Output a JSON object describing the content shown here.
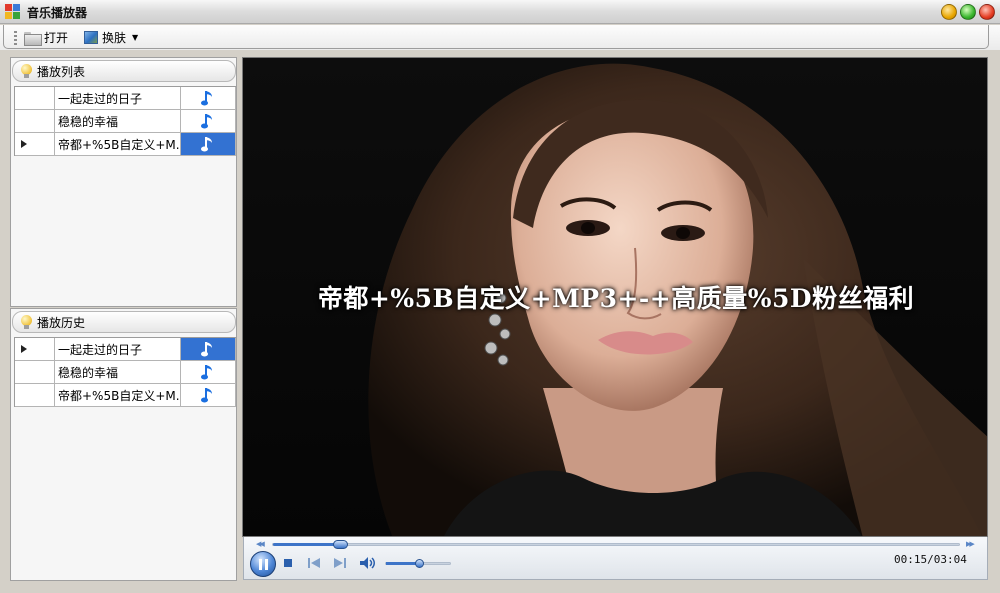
{
  "window": {
    "title": "音乐播放器",
    "icon": "app-window-icon"
  },
  "toolbar": {
    "open_label": "打开",
    "skin_label": "换肤",
    "open_icon": "folder-open-icon",
    "skin_icon": "picture-icon"
  },
  "playlist": {
    "title": "播放列表",
    "items": [
      {
        "name": "一起走过的日子",
        "current": false,
        "selected": false
      },
      {
        "name": "稳稳的幸福",
        "current": false,
        "selected": false
      },
      {
        "name": "帝都+%5B自定义+M...",
        "current": true,
        "selected": true
      }
    ]
  },
  "history": {
    "title": "播放历史",
    "items": [
      {
        "name": "一起走过的日子",
        "current": true,
        "selected": true
      },
      {
        "name": "稳稳的幸福",
        "current": false,
        "selected": false
      },
      {
        "name": "帝都+%5B自定义+M...",
        "current": false,
        "selected": false
      }
    ]
  },
  "video": {
    "lyric_text": "帝都+%5B自定义+MP3+-+高质量%5D粉丝福利"
  },
  "player": {
    "time_display": "00:15/03:04",
    "progress_fraction": 0.097,
    "volume_fraction": 0.5,
    "state": "playing"
  },
  "colors": {
    "selection_blue": "#3372d2",
    "note_icon_blue": "#1b6fe0",
    "accent_blue": "#3d74c8"
  }
}
